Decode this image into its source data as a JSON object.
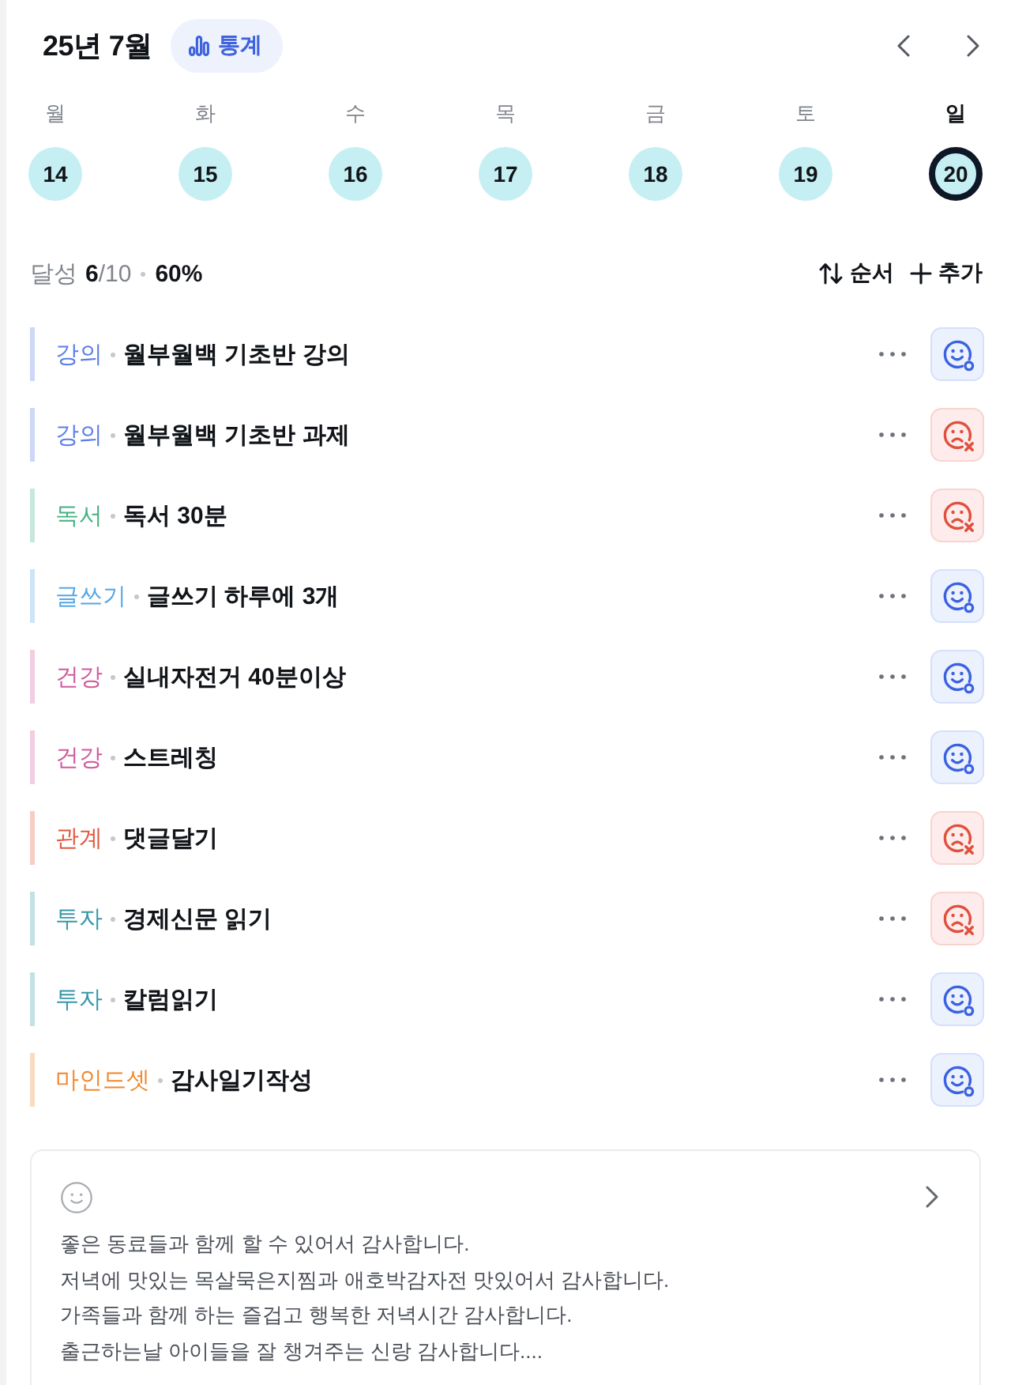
{
  "header": {
    "title": "25년 7월",
    "stats_button": "통계"
  },
  "week": [
    {
      "weekday": "월",
      "date": "14",
      "selected": false
    },
    {
      "weekday": "화",
      "date": "15",
      "selected": false
    },
    {
      "weekday": "수",
      "date": "16",
      "selected": false
    },
    {
      "weekday": "목",
      "date": "17",
      "selected": false
    },
    {
      "weekday": "금",
      "date": "18",
      "selected": false
    },
    {
      "weekday": "토",
      "date": "19",
      "selected": false
    },
    {
      "weekday": "일",
      "date": "20",
      "selected": true
    }
  ],
  "summary": {
    "label": "달성",
    "done": "6",
    "total": "/10",
    "percent": "60%"
  },
  "actions": [
    {
      "kind": "sort",
      "label": "순서"
    },
    {
      "kind": "add",
      "label": "추가"
    }
  ],
  "habits": [
    {
      "category": "강의",
      "color": "#5b7fe6",
      "title": "월부월백 기초반 강의",
      "done": true
    },
    {
      "category": "강의",
      "color": "#5b7fe6",
      "title": "월부월백 기초반 과제",
      "done": false
    },
    {
      "category": "독서",
      "color": "#45b083",
      "title": "독서 30분",
      "done": false
    },
    {
      "category": "글쓰기",
      "color": "#58a8e4",
      "title": "글쓰기 하루에 3개",
      "done": true
    },
    {
      "category": "건강",
      "color": "#cf5c9d",
      "title": "실내자전거 40분이상",
      "done": true
    },
    {
      "category": "건강",
      "color": "#cf5c9d",
      "title": "스트레칭",
      "done": true
    },
    {
      "category": "관계",
      "color": "#e2583f",
      "title": "댓글달기",
      "done": false
    },
    {
      "category": "투자",
      "color": "#3a97a8",
      "title": "경제신문 읽기",
      "done": false
    },
    {
      "category": "투자",
      "color": "#3a97a8",
      "title": "칼럼읽기",
      "done": true
    },
    {
      "category": "마인드셋",
      "color": "#f0892f",
      "title": "감사일기작성",
      "done": true
    }
  ],
  "memo": {
    "lines": [
      "좋은 동료들과 함께 할 수 있어서 감사합니다.",
      "저녁에 맛있는 목살묵은지찜과 애호박감자전 맛있어서 감사합니다.",
      "가족들과 함께 하는 즐겁고 행복한 저녁시간 감사합니다.",
      "출근하는날 아이들을 잘 챙겨주는 신랑 감사합니다...."
    ]
  }
}
